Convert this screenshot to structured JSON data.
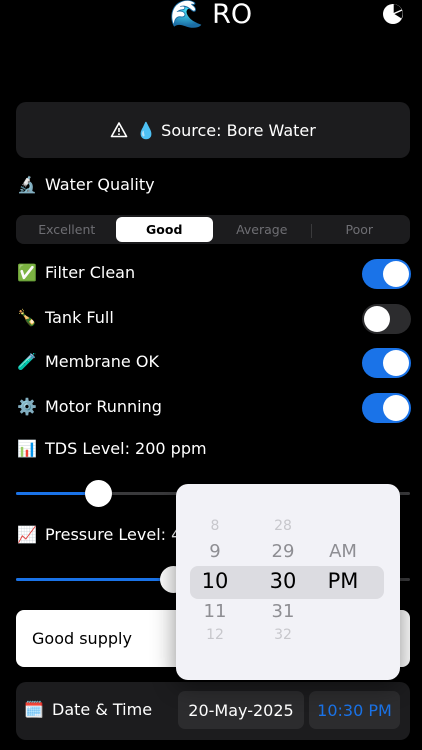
{
  "header": {
    "title": "🌊 RO",
    "chart_icon": "pie-chart-icon"
  },
  "source": {
    "label": "💧 Source: Bore Water",
    "icon": "warning-triangle-icon"
  },
  "quality": {
    "emoji": "🔬",
    "label": "Water Quality",
    "options": [
      "Excellent",
      "Good",
      "Average",
      "Poor"
    ],
    "selected": "Good"
  },
  "toggles": [
    {
      "emoji": "✅",
      "label": "Filter Clean",
      "on": true
    },
    {
      "emoji": "🍾",
      "label": "Tank Full",
      "on": false
    },
    {
      "emoji": "🧪",
      "label": "Membrane OK",
      "on": true
    },
    {
      "emoji": "⚙️",
      "label": "Motor Running",
      "on": true
    }
  ],
  "tds": {
    "emoji": "📊",
    "label": "TDS Level: 200 ppm",
    "fraction": 0.21
  },
  "pressure": {
    "emoji": "📈",
    "label": "Pressure Level: 40",
    "fraction": 0.4
  },
  "supply_field": {
    "value": "Good supply"
  },
  "datetime": {
    "emoji": "🗓️",
    "label": "Date & Time",
    "date": "20-May-2025",
    "time": "10:30 PM"
  },
  "time_picker": {
    "hours": [
      "8",
      "9",
      "10",
      "11",
      "12"
    ],
    "minutes": [
      "28",
      "29",
      "30",
      "31",
      "32"
    ],
    "periods": [
      "AM",
      "PM"
    ],
    "selected_hour": "10",
    "selected_minute": "30",
    "selected_period": "PM"
  },
  "colors": {
    "accent": "#1a73e8",
    "card": "#1c1c1e",
    "background": "#000000"
  }
}
